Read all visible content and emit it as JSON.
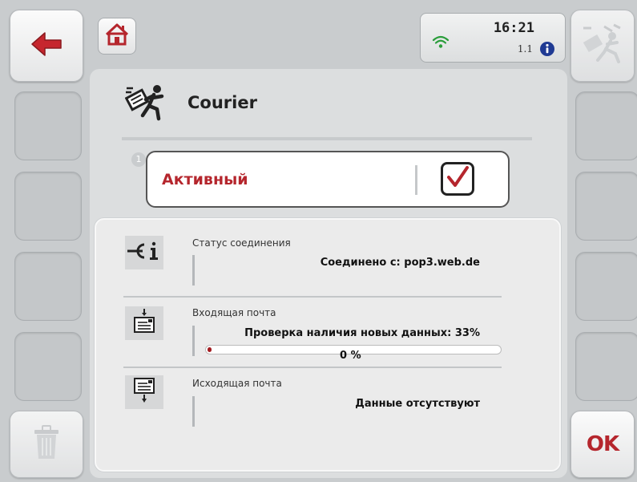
{
  "status": {
    "time": "16:21",
    "version": "1.1"
  },
  "title": "Courier",
  "step_number": "1",
  "active_label": "Активный",
  "active_checked": true,
  "connection": {
    "label": "Статус соединения",
    "value": "Соединено с: pop3.web.de"
  },
  "incoming": {
    "label": "Входящая почта",
    "value": "Проверка наличия новых данных: 33%",
    "progress_text": "0 %",
    "progress_fraction": 0.01
  },
  "outgoing": {
    "label": "Исходящая почта",
    "value": "Данные отсутствуют"
  },
  "ok_label": "OK",
  "colors": {
    "accent_red": "#b5262d",
    "wifi_green": "#2a9d3a",
    "info_blue": "#1f3a93"
  },
  "icons": {
    "back": "arrow-left-icon",
    "home": "home-icon",
    "wifi": "wifi-icon",
    "info": "info-icon",
    "courier": "courier-icon",
    "trash": "trash-icon",
    "connection": "connection-info-icon",
    "inbox": "incoming-mail-icon",
    "outbox": "outgoing-mail-icon"
  }
}
